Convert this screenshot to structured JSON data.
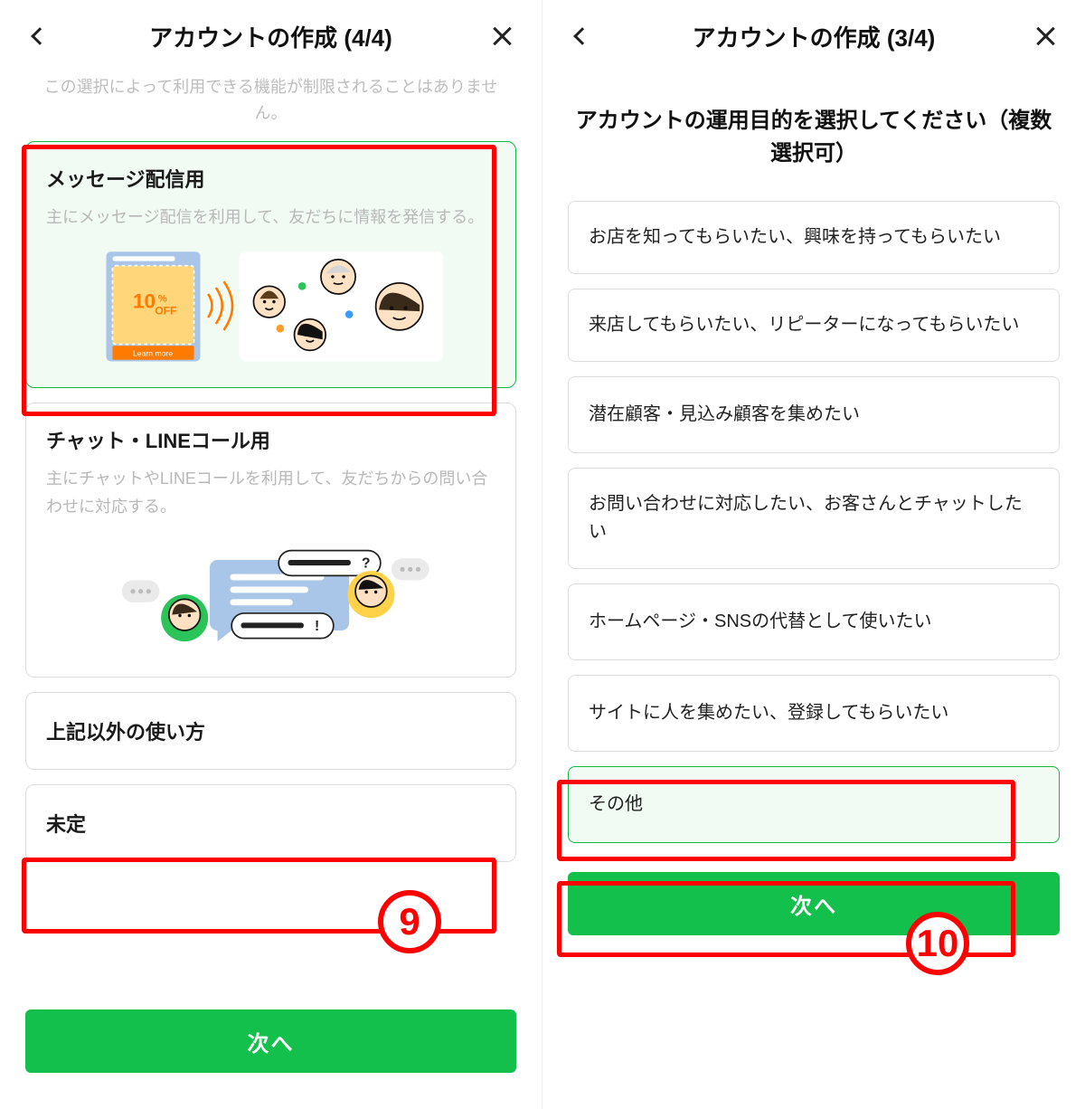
{
  "left": {
    "header_title": "アカウントの作成 (4/4)",
    "subtext": "この選択によって利用できる機能が制限されることはありません。",
    "options": [
      {
        "title": "メッセージ配信用",
        "desc": "主にメッセージ配信を利用して、友だちに情報を発信する。",
        "selected": true,
        "promo_text": "10%",
        "promo_sub": "OFF",
        "promo_cta": "Learn more"
      },
      {
        "title": "チャット・LINEコール用",
        "desc": "主にチャットやLINEコールを利用して、友だちからの問い合わせに対応する。",
        "selected": false
      },
      {
        "title": "上記以外の使い方",
        "selected": false
      },
      {
        "title": "未定",
        "selected": false
      }
    ],
    "next_label": "次へ",
    "annotation_badge": "9"
  },
  "right": {
    "header_title": "アカウントの作成 (3/4)",
    "heading": "アカウントの運用目的を選択してください（複数選択可）",
    "purposes": [
      {
        "label": "お店を知ってもらいたい、興味を持ってもらいたい",
        "selected": false
      },
      {
        "label": "来店してもらいたい、リピーターになってもらいたい",
        "selected": false
      },
      {
        "label": "潜在顧客・見込み顧客を集めたい",
        "selected": false
      },
      {
        "label": "お問い合わせに対応したい、お客さんとチャットしたい",
        "selected": false
      },
      {
        "label": "ホームページ・SNSの代替として使いたい",
        "selected": false
      },
      {
        "label": "サイトに人を集めたい、登録してもらいたい",
        "selected": false
      },
      {
        "label": "その他",
        "selected": true
      }
    ],
    "next_label": "次へ",
    "annotation_badge": "10"
  },
  "colors": {
    "accent": "#13c04c",
    "annotation": "#ff0000"
  }
}
